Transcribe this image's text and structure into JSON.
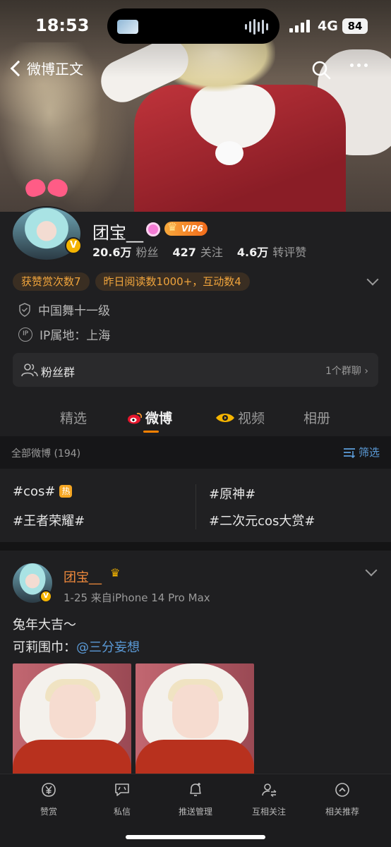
{
  "status_bar": {
    "time": "18:53",
    "network": "4G",
    "battery": "84"
  },
  "nav": {
    "back_label": "微博正文"
  },
  "profile": {
    "name": "团宝__",
    "vip_label": "VIP6",
    "verified_mark": "V",
    "stats": [
      {
        "value": "20.6万",
        "label": "粉丝"
      },
      {
        "value": "427",
        "label": "关注"
      },
      {
        "value": "4.6万",
        "label": "转评赞"
      }
    ],
    "chips": [
      "获赞赏次数7",
      "昨日阅读数1000+，互动数4"
    ],
    "level": "中国舞十一级",
    "ip_location": "IP属地：上海",
    "ip_icon_text": "IP",
    "fans_group": {
      "label": "粉丝群",
      "count": "1个群聊"
    }
  },
  "tabs": [
    {
      "label": "精选"
    },
    {
      "label": "微博"
    },
    {
      "label": "视频"
    },
    {
      "label": "相册"
    }
  ],
  "filter": {
    "count_text": "全部微博 (194)",
    "filter_label": "筛选"
  },
  "topics": [
    {
      "label": "#cos#",
      "hot": "热"
    },
    {
      "label": "#原神#"
    },
    {
      "label": "#王者荣耀#"
    },
    {
      "label": "#二次元cos大赏#"
    }
  ],
  "post": {
    "author": "团宝__",
    "meta": "1-25  来自iPhone 14 Pro Max",
    "line1": "兔年大吉～",
    "line2_prefix": "可莉围巾：",
    "mention": "@三分妄想"
  },
  "toolbar": [
    {
      "label": "赞赏",
      "icon": "yuan-icon"
    },
    {
      "label": "私信",
      "icon": "message-icon"
    },
    {
      "label": "推送管理",
      "icon": "bell-icon"
    },
    {
      "label": "互相关注",
      "icon": "mutual-follow-icon"
    },
    {
      "label": "相关推荐",
      "icon": "recommend-icon"
    }
  ],
  "colors": {
    "accent": "#ff8200",
    "link": "#5b9bd8",
    "chip_text": "#f0a43c",
    "author": "#f08a3c"
  }
}
